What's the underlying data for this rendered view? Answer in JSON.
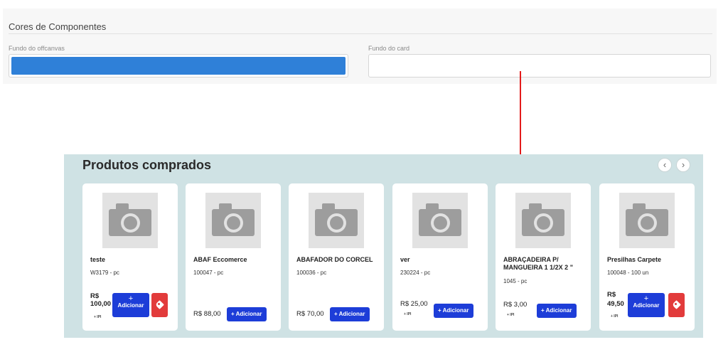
{
  "settings": {
    "title": "Cores de Componentes",
    "offcanvas_label": "Fundo do offcanvas",
    "offcanvas_color": "#2f80d8",
    "card_label": "Fundo do card",
    "card_color": "#ffffff"
  },
  "section": {
    "title": "Produtos comprados",
    "prev_icon": "‹",
    "next_icon": "›",
    "background": "#cfe2e4"
  },
  "products": [
    {
      "name": "teste",
      "code": "W3179 - pc",
      "price_prefix": "R$",
      "price_value": "100,00",
      "ipi": "+ IPI",
      "add_plus": "+",
      "add_label": "Adicionar",
      "has_tag": true
    },
    {
      "name": "ABAF Eccomerce",
      "code": "100047 - pc",
      "price": "R$ 88,00",
      "add_label": "+ Adicionar"
    },
    {
      "name": "ABAFADOR DO CORCEL",
      "code": "100036 - pc",
      "price": "R$ 70,00",
      "add_label": "+ Adicionar"
    },
    {
      "name": "ver",
      "code": "230224 - pc",
      "price": "R$ 25,00",
      "ipi": "+ IPI",
      "add_label": "+ Adicionar"
    },
    {
      "name": "ABRAÇADEIRA P/ MANGUEIRA 1 1/2X 2 \"",
      "code": "1045 - pc",
      "price": "R$ 3,00",
      "ipi": "+ IPI",
      "add_label": "+ Adicionar"
    },
    {
      "name": "Presilhas Carpete",
      "code": "100048 - 100 un",
      "price_prefix": "R$",
      "price_value": "49,50",
      "ipi": "+ IPI",
      "add_plus": "+",
      "add_label": "Adicionar",
      "has_tag": true
    }
  ]
}
